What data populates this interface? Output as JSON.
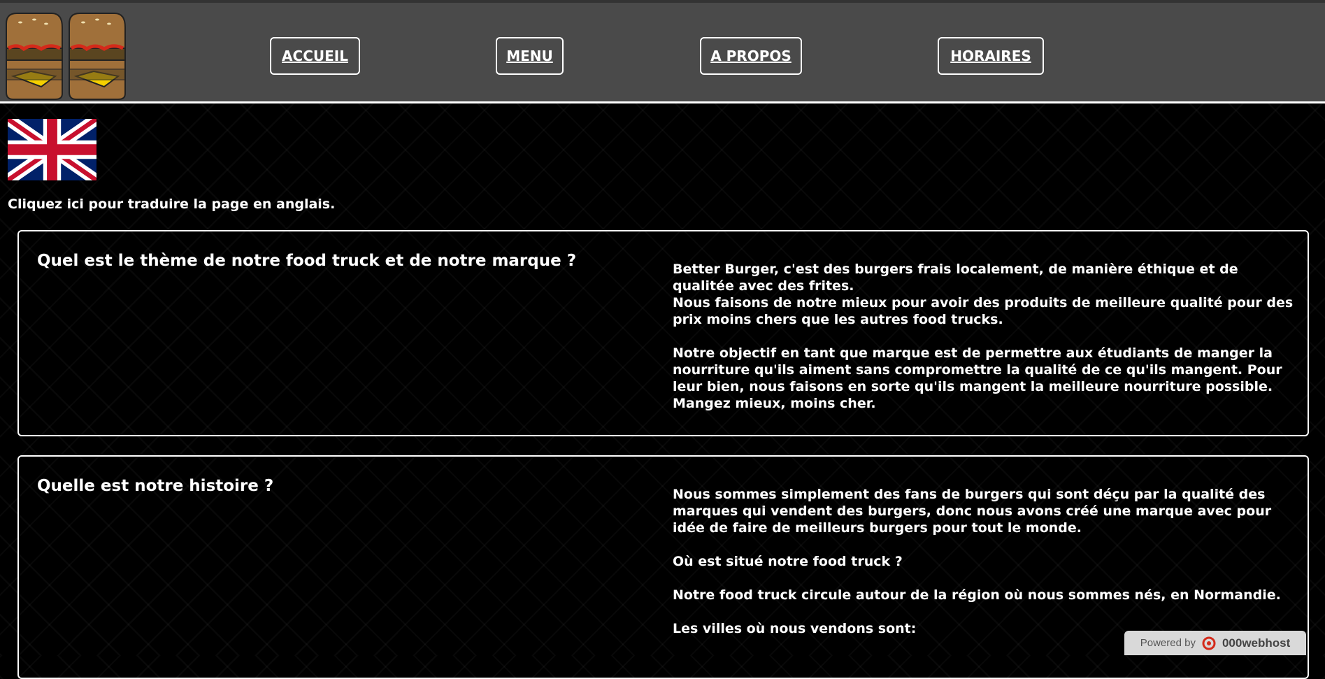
{
  "header": {
    "logo": {
      "icon": "burger-logo",
      "letters": "BB"
    },
    "nav": [
      {
        "label": "ACCUEIL"
      },
      {
        "label": "MENU"
      },
      {
        "label": "A PROPOS"
      },
      {
        "label": "HORAIRES"
      }
    ]
  },
  "translate": {
    "flag_icon": "uk-flag-icon",
    "text": "Cliquez ici pour traduire la page en anglais."
  },
  "sections": [
    {
      "title": "Quel est le thème de notre food truck et de notre marque ?",
      "paragraphs": [
        "Better Burger, c'est des burgers frais localement, de manière éthique et de qualitée avec des frites.",
        "Nous faisons de notre mieux pour avoir des produits de meilleure qualité pour des prix moins chers que les autres food trucks.",
        "",
        "Notre objectif en tant que marque est de permettre aux étudiants de manger la nourriture qu'ils aiment sans compromettre la qualité de ce qu'ils mangent. Pour leur bien, nous faisons en sorte qu'ils mangent la meilleure nourriture possible. Mangez mieux, moins cher."
      ]
    },
    {
      "title": "Quelle est notre histoire ?",
      "paragraphs": [
        "Nous sommes simplement des fans de burgers qui sont déçu par la qualité des marques qui vendent des burgers, donc nous avons créé une marque avec pour idée de faire de meilleurs burgers pour tout le monde.",
        "",
        "Où est situé notre food truck ?",
        "",
        "Notre food truck circule autour de la région où nous sommes nés, en Normandie.",
        "",
        "Les villes où nous vendons sont:"
      ]
    }
  ],
  "footer_badge": {
    "powered_by": "Powered by",
    "brand": "000webhost"
  },
  "colors": {
    "header_bg": "#4a4a4a",
    "page_bg": "#000000",
    "text": "#ffffff",
    "logo_brown": "#a0703a",
    "logo_dark": "#5a4520",
    "logo_cheese": "#f5d000",
    "logo_ketchup": "#d42a1a"
  }
}
